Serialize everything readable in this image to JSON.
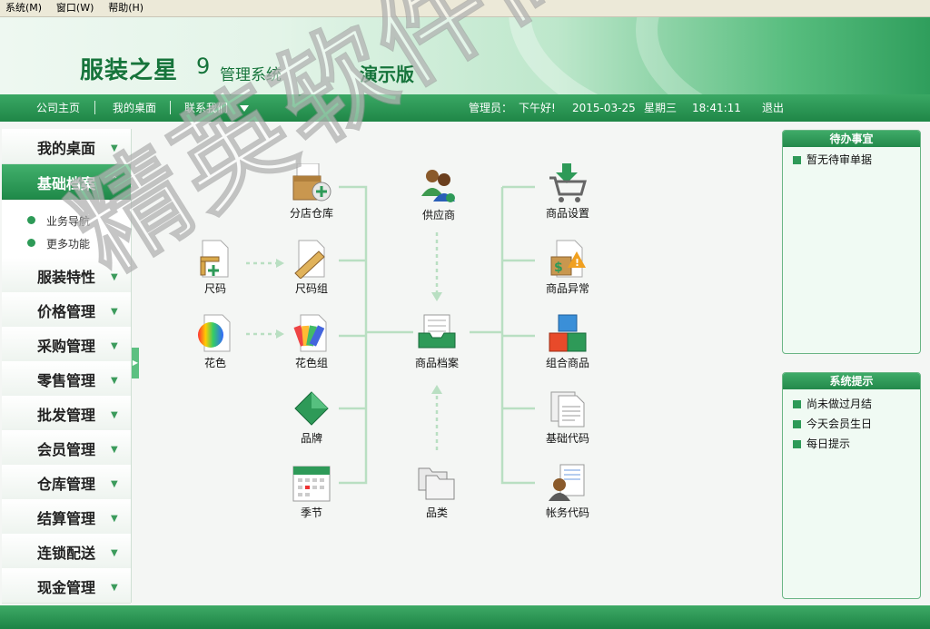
{
  "menubar": {
    "items": [
      "系统(M)",
      "窗口(W)",
      "帮助(H)"
    ]
  },
  "banner": {
    "product_name": "服装之星",
    "version": "9",
    "subtitle": "管理系统",
    "edition": "演示版"
  },
  "navbar": {
    "links": [
      "公司主页",
      "我的桌面",
      "联系我们"
    ],
    "user_label": "管理员：",
    "greeting": "下午好!",
    "date": "2015-03-25",
    "weekday": "星期三",
    "time": "18:41:11",
    "logout": "退出"
  },
  "sidebar": {
    "items": [
      "我的桌面",
      "基础档案",
      "服装特性",
      "价格管理",
      "采购管理",
      "零售管理",
      "批发管理",
      "会员管理",
      "仓库管理",
      "结算管理",
      "连锁配送",
      "现金管理"
    ],
    "active": "基础档案",
    "subitems": [
      "业务导航",
      "更多功能"
    ]
  },
  "flow": {
    "nodes": {
      "store_warehouse": "分店仓库",
      "size": "尺码",
      "size_group": "尺码组",
      "color": "花色",
      "color_group": "花色组",
      "brand": "品牌",
      "season": "季节",
      "supplier": "供应商",
      "product_file": "商品档案",
      "category": "品类",
      "product_settings": "商品设置",
      "product_exception": "商品异常",
      "combo_product": "组合商品",
      "basic_code": "基础代码",
      "account_code": "帐务代码"
    }
  },
  "pending_panel": {
    "title": "待办事宜",
    "items": [
      "暂无待审单据"
    ]
  },
  "tips_panel": {
    "title": "系统提示",
    "items": [
      "尚未做过月结",
      "今天会员生日",
      "每日提示"
    ]
  },
  "watermark": {
    "text": "精英软件商城"
  },
  "colors": {
    "primary": "#1f8647",
    "accent": "#3aa864",
    "panel_bg": "#f0faf3"
  }
}
